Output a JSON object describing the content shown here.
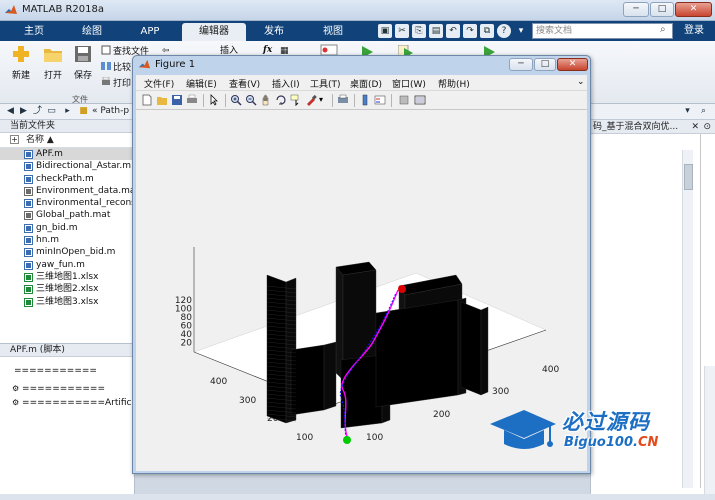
{
  "window": {
    "title": "MATLAB R2018a",
    "minimize": "─",
    "restore": "□",
    "close": "✕"
  },
  "tabs": [
    {
      "label": "主页",
      "active": false
    },
    {
      "label": "绘图",
      "active": false
    },
    {
      "label": "APP",
      "active": false
    },
    {
      "label": "编辑器",
      "active": true
    },
    {
      "label": "发布",
      "active": false
    },
    {
      "label": "视图",
      "active": false
    }
  ],
  "quick_access": [
    "save",
    "cut",
    "copy",
    "paste",
    "undo",
    "redo",
    "switch",
    "help"
  ],
  "search": {
    "placeholder": "搜索文档"
  },
  "login_label": "登录",
  "ribbon": {
    "new_label": "新建",
    "open_label": "打开",
    "save_label": "保存",
    "find_files_label": "查找文件",
    "compare_label": "比较",
    "print_label": "打印",
    "insert_label": "插入",
    "fx_label": "fx",
    "group_file": "文件"
  },
  "address": {
    "path": "« Path-p"
  },
  "current_folder": {
    "header": "当前文件夹",
    "column_name": "名称 ▲",
    "files": [
      {
        "name": "APF.m",
        "type": "m",
        "selected": true
      },
      {
        "name": "Bidirectional_Astar.m",
        "type": "m",
        "selected": false
      },
      {
        "name": "checkPath.m",
        "type": "m",
        "selected": false
      },
      {
        "name": "Environment_data.mat",
        "type": "mat",
        "selected": false
      },
      {
        "name": "Environmental_recons",
        "type": "m",
        "selected": false
      },
      {
        "name": "Global_path.mat",
        "type": "mat",
        "selected": false
      },
      {
        "name": "gn_bid.m",
        "type": "m",
        "selected": false
      },
      {
        "name": "hn.m",
        "type": "m",
        "selected": false
      },
      {
        "name": "minInOpen_bid.m",
        "type": "m",
        "selected": false
      },
      {
        "name": "yaw_fun.m",
        "type": "m",
        "selected": false
      },
      {
        "name": "三维地图1.xlsx",
        "type": "xlsx",
        "selected": false
      },
      {
        "name": "三维地图2.xlsx",
        "type": "xlsx",
        "selected": false
      },
      {
        "name": "三维地图3.xlsx",
        "type": "xlsx",
        "selected": false
      }
    ]
  },
  "editor_panel": {
    "header": "APF.m (脚本)",
    "lines": [
      "===========",
      "===========",
      "===========Artificia"
    ]
  },
  "right_panel": {
    "header": "码_基于混合双向优..."
  },
  "figure": {
    "title": "Figure 1",
    "menus": [
      "文件(F)",
      "编辑(E)",
      "查看(V)",
      "插入(I)",
      "工具(T)",
      "桌面(D)",
      "窗口(W)",
      "帮助(H)"
    ],
    "toolbar": [
      "new-figure",
      "open",
      "save",
      "print",
      "pointer",
      "zoom-in",
      "zoom-out",
      "pan",
      "rotate",
      "data-cursor",
      "brush",
      "print-preview",
      "link",
      "colorbar",
      "legend",
      "hide-plot",
      "show-plot"
    ]
  },
  "chart_data": {
    "type": "3d-obstacle-map",
    "z_ticks": [
      "120",
      "100",
      "80",
      "60",
      "40",
      "20"
    ],
    "y_ticks": [
      "400",
      "300",
      "200",
      "100"
    ],
    "x_ticks": [
      "100",
      "200",
      "300",
      "400"
    ],
    "start_color": "#00cc00",
    "goal_color": "#dd0000",
    "path_colors": [
      "#ff00ff",
      "#1a1aff"
    ],
    "obstacle_color": "#000000"
  },
  "watermark": {
    "text_cn": "必过源码",
    "text_en_prefix": "Biguo100.",
    "text_en_suffix": "CN"
  }
}
